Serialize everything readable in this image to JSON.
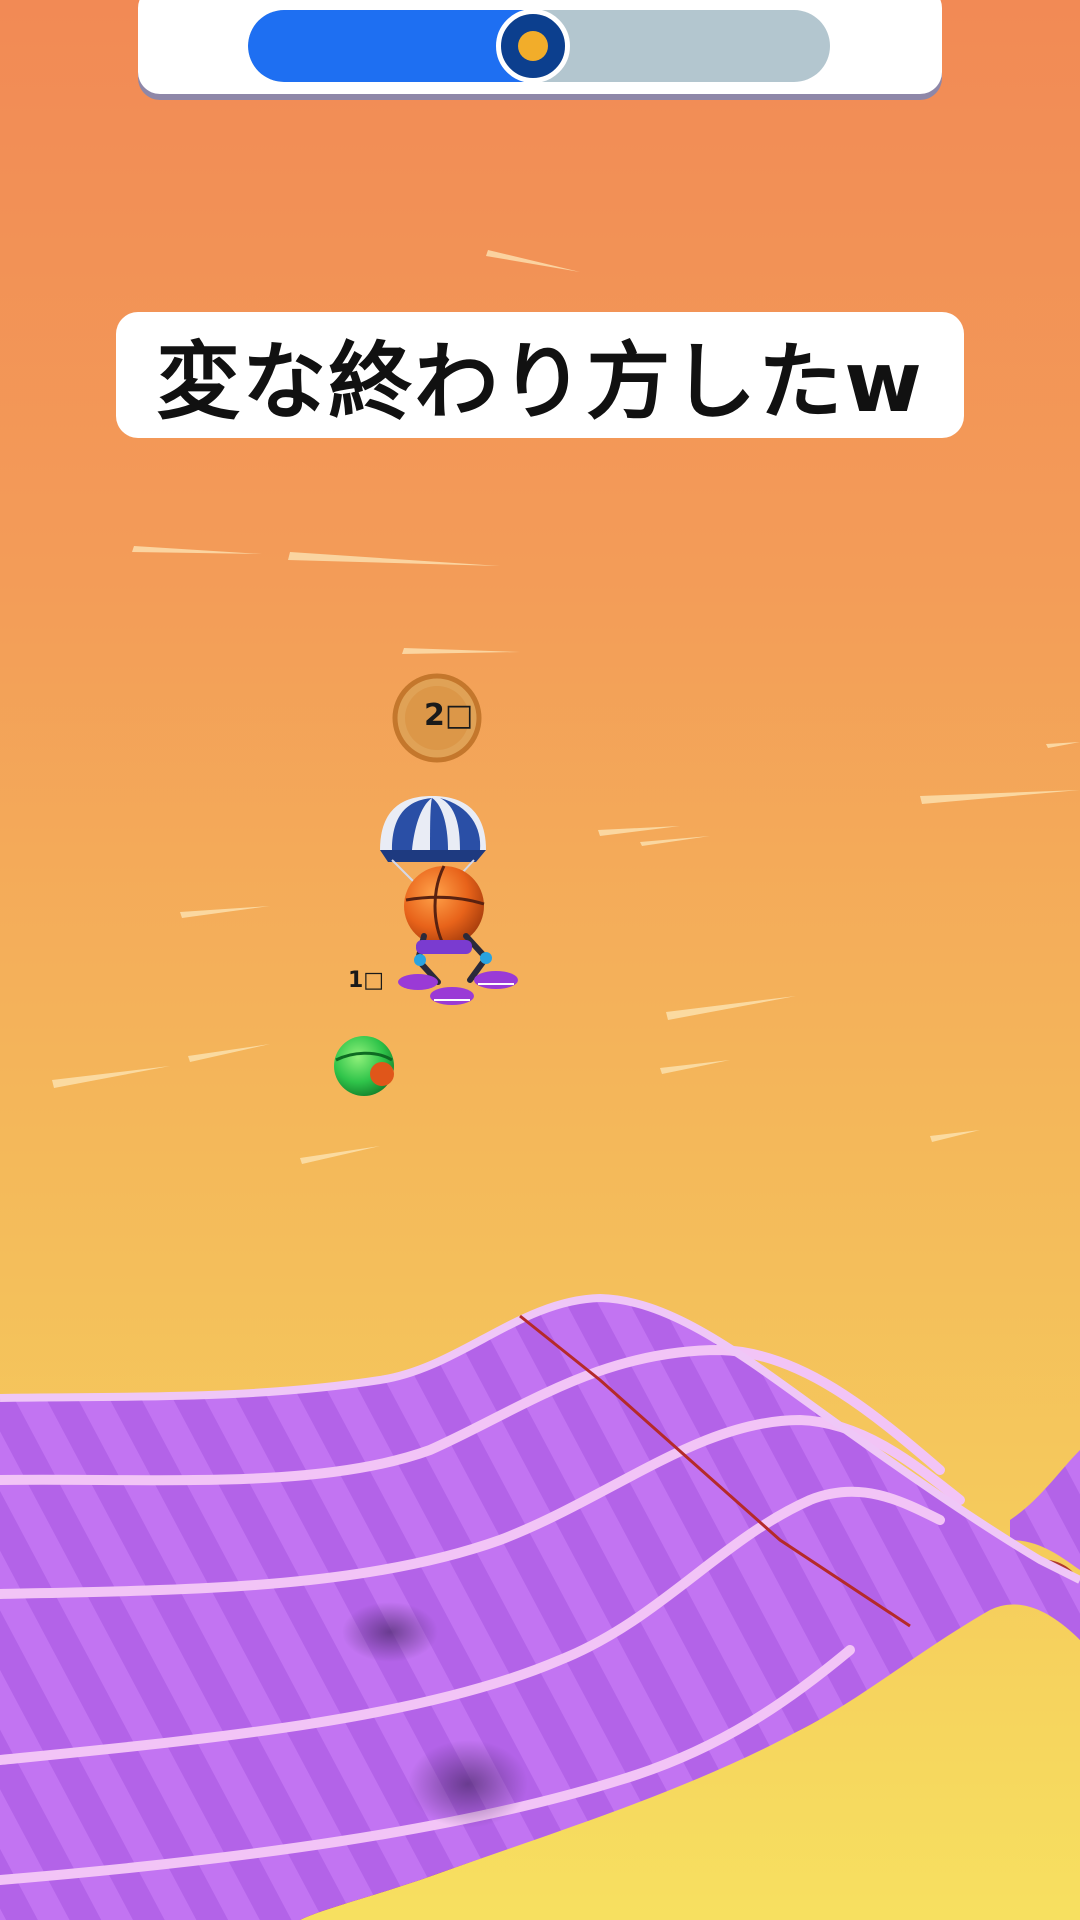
{
  "hud": {
    "progress": 0.49,
    "progress_fill_color": "#1e6ff2",
    "progress_track_color": "#b3c6cf",
    "knob_icon": "player-position-icon"
  },
  "caption": {
    "text": "変な終わり方したw"
  },
  "opponent": {
    "rank_label": "2□"
  },
  "player": {
    "rank_label": "1□"
  },
  "colors": {
    "sky_top": "#f28a55",
    "sky_mid": "#f3ad58",
    "sky_bottom": "#f6d85c",
    "track_purple": "#c073f0",
    "track_edge": "#b0382f"
  }
}
